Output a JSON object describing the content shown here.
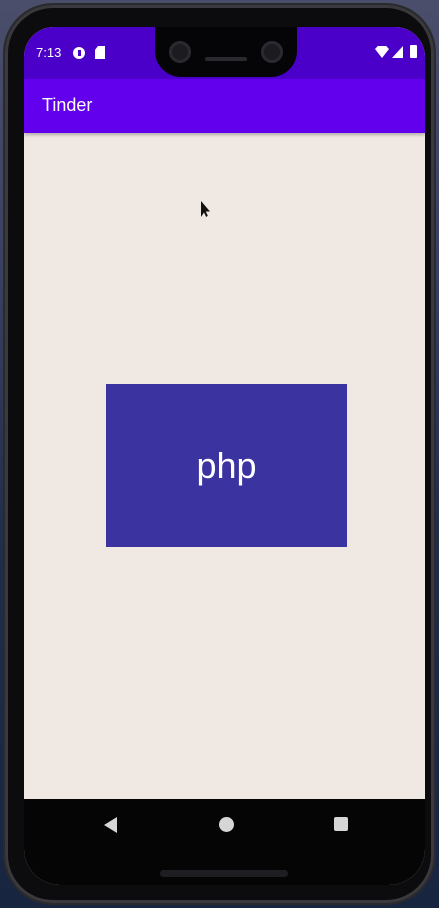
{
  "status_bar": {
    "time": "7:13"
  },
  "app_bar": {
    "title": "Tinder"
  },
  "card": {
    "label": "php"
  },
  "colors": {
    "status_bar": "#4b00c9",
    "app_bar": "#6200ee",
    "card": "#3a33a0",
    "background": "#f0e8e2"
  }
}
